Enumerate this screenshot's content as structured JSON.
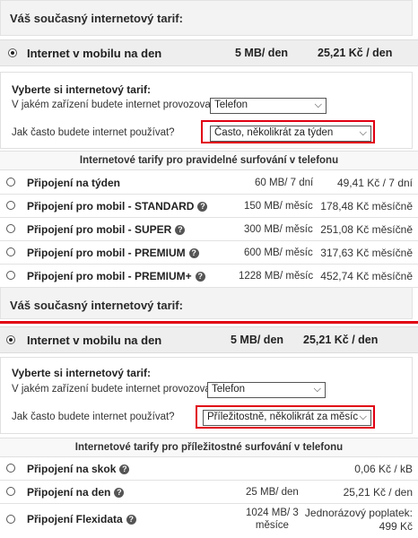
{
  "top": {
    "title": "Váš současný internetový tarif:",
    "current": {
      "name": "Internet v mobilu na den",
      "size": "5 MB/ den",
      "price": "25,21 Kč / den"
    },
    "selector": {
      "heading": "Vyberte si internetový tarif:",
      "device_label": "V jakém zařízení budete internet provozovat?",
      "device_value": "Telefon",
      "freq_label": "Jak často budete internet používat?",
      "freq_value": "Často, několikrát za týden"
    },
    "group_heading": "Internetové tarify pro pravidelné surfování v telefonu",
    "tarifs": [
      {
        "name": "Připojení na týden",
        "help": false,
        "data": "60 MB/ 7 dní",
        "price": "49,41 Kč / 7 dní"
      },
      {
        "name": "Připojení pro mobil - STANDARD",
        "help": true,
        "data": "150 MB/ měsíc",
        "price": "178,48 Kč měsíčně"
      },
      {
        "name": "Připojení pro mobil - SUPER",
        "help": true,
        "data": "300 MB/ měsíc",
        "price": "251,08 Kč měsíčně"
      },
      {
        "name": "Připojení pro mobil - PREMIUM",
        "help": true,
        "data": "600 MB/ měsíc",
        "price": "317,63 Kč měsíčně"
      },
      {
        "name": "Připojení pro mobil - PREMIUM+",
        "help": true,
        "data": "1228 MB/ měsíc",
        "price": "452,74 Kč měsíčně"
      }
    ]
  },
  "bottom": {
    "title": "Váš současný internetový tarif:",
    "current": {
      "name": "Internet v mobilu na den",
      "size": "5 MB/ den",
      "price": "25,21 Kč / den"
    },
    "selector": {
      "heading": "Vyberte si internetový tarif:",
      "device_label": "V jakém zařízení budete internet provozovat?",
      "device_value": "Telefon",
      "freq_label": "Jak často budete internet používat?",
      "freq_value": "Příležitostně, několikrát za měsíc"
    },
    "group_heading": "Internetové tarify pro příležitostné surfování v telefonu",
    "tarifs": [
      {
        "name": "Připojení na skok",
        "help": true,
        "data": "",
        "price": "0,06 Kč / kB"
      },
      {
        "name": "Připojení na den",
        "help": true,
        "data": "25 MB/ den",
        "price": "25,21 Kč / den"
      },
      {
        "name": "Připojení Flexidata",
        "help": true,
        "data_line1": "1024 MB/ 3",
        "data_line2": "měsíce",
        "price_line1": "Jednorázový poplatek:",
        "price_line2": "499 Kč"
      }
    ]
  },
  "icons": {
    "help": "question-circle-icon",
    "chevron": "chevron-down-icon",
    "radio": "radio-icon"
  },
  "colors": {
    "highlight": "#e10012",
    "row_bg": "#eeeeee"
  }
}
